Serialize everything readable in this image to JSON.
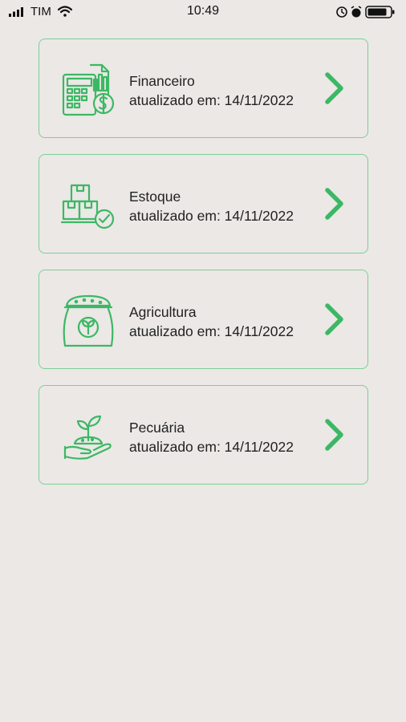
{
  "status_bar": {
    "carrier": "TIM",
    "time": "10:49"
  },
  "cards": [
    {
      "title": "Financeiro",
      "subtitle": "atualizado em: 14/11/2022",
      "icon": "finance-calculator-icon"
    },
    {
      "title": "Estoque",
      "subtitle": "atualizado em: 14/11/2022",
      "icon": "stock-boxes-icon"
    },
    {
      "title": "Agricultura",
      "subtitle": "atualizado em: 14/11/2022",
      "icon": "seed-bag-icon"
    },
    {
      "title": "Pecuária",
      "subtitle": "atualizado em: 14/11/2022",
      "icon": "sprout-hand-icon"
    }
  ],
  "colors": {
    "accent": "#3cb864",
    "card_border": "#7ccf96",
    "background": "#ebe8e6"
  }
}
